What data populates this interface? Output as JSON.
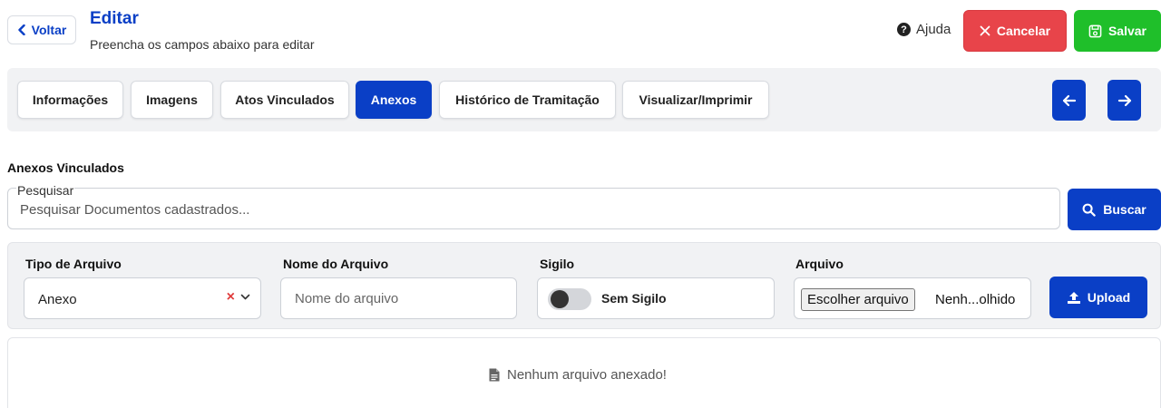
{
  "header": {
    "back_label": "Voltar",
    "title": "Editar",
    "subtitle": "Preencha os campos abaixo para editar",
    "help_label": "Ajuda",
    "cancel_label": "Cancelar",
    "save_label": "Salvar"
  },
  "tabs": [
    {
      "label": "Informações",
      "active": false
    },
    {
      "label": "Imagens",
      "active": false
    },
    {
      "label": "Atos Vinculados",
      "active": false
    },
    {
      "label": "Anexos",
      "active": true
    },
    {
      "label": "Histórico de Tramitação",
      "active": false
    },
    {
      "label": "Visualizar/Imprimir",
      "active": false
    }
  ],
  "section": {
    "title": "Anexos Vinculados"
  },
  "search": {
    "legend": "Pesquisar",
    "placeholder": "Pesquisar Documentos cadastrados...",
    "button_label": "Buscar"
  },
  "form": {
    "tipo_label": "Tipo de Arquivo",
    "tipo_value": "Anexo",
    "nome_label": "Nome do Arquivo",
    "nome_placeholder": "Nome do arquivo",
    "sigilo_label": "Sigilo",
    "sigilo_value": "Sem Sigilo",
    "arquivo_label": "Arquivo",
    "file_button_label": "Escolher arquivo",
    "file_status": "Nenh...olhido",
    "upload_label": "Upload"
  },
  "empty": {
    "message": "Nenhum arquivo anexado!"
  },
  "colors": {
    "primary": "#0a3fc6",
    "danger": "#e8444a",
    "success": "#1fbf2a",
    "panel_bg": "#f1f2f4"
  }
}
